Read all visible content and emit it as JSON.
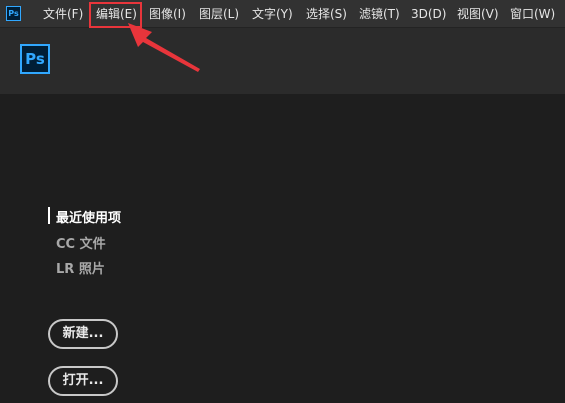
{
  "app": {
    "small_icon_text": "Ps",
    "logo_text": "Ps",
    "brand_color": "#31a8ff",
    "brand_bg": "#001e36"
  },
  "menu": {
    "items": [
      {
        "label": "文件(F)"
      },
      {
        "label": "编辑(E)"
      },
      {
        "label": "图像(I)"
      },
      {
        "label": "图层(L)"
      },
      {
        "label": "文字(Y)"
      },
      {
        "label": "选择(S)"
      },
      {
        "label": "滤镜(T)"
      },
      {
        "label": "3D(D)"
      },
      {
        "label": "视图(V)"
      },
      {
        "label": "窗口(W)"
      }
    ],
    "highlighted_item": "编辑(E)",
    "highlight_color": "#e8353b"
  },
  "sidebar": {
    "items": [
      {
        "label": "最近使用项",
        "active": true
      },
      {
        "label": "CC 文件",
        "active": false
      },
      {
        "label": "LR 照片",
        "active": false
      }
    ]
  },
  "buttons": {
    "new_label": "新建...",
    "open_label": "打开..."
  }
}
